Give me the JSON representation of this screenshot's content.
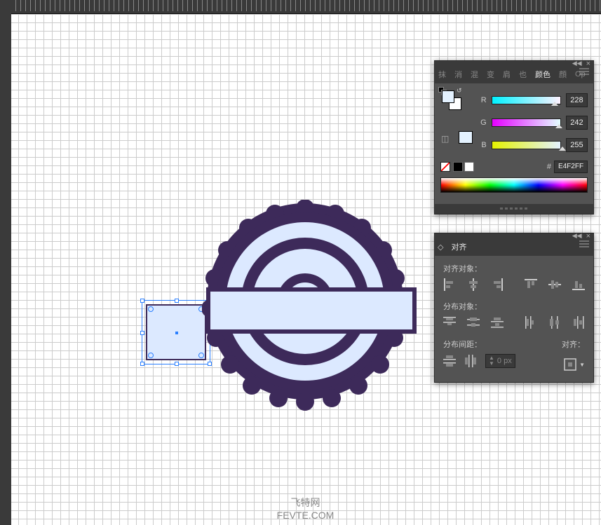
{
  "color_panel": {
    "tabs": [
      "抹",
      "消",
      "混",
      "变",
      "肩",
      "也"
    ],
    "active_tab": "颜色",
    "tabs_right": [
      "顔",
      "Op"
    ],
    "r_label": "R",
    "r_value": "228",
    "g_label": "G",
    "g_value": "242",
    "b_label": "B",
    "b_value": "255",
    "hex_label": "#",
    "hex_value": "E4F2FF",
    "fill_color": "#E4F2FF"
  },
  "align_panel": {
    "tab": "对齐",
    "section_align": "对齐对象：",
    "section_distribute": "分布对象：",
    "section_spacing": "分布间距：",
    "align_to_label": "对齐：",
    "spacing_value": "0 px",
    "buttons": {
      "align_left": "align-left",
      "align_hcenter": "align-hcenter",
      "align_right": "align-right",
      "align_top": "align-top",
      "align_vcenter": "align-vcenter",
      "align_bottom": "align-bottom",
      "dist_top": "dist-top",
      "dist_vcenter": "dist-vcenter",
      "dist_bottom": "dist-bottom",
      "dist_left": "dist-left",
      "dist_hcenter": "dist-hcenter",
      "dist_right": "dist-right",
      "space_v": "space-v",
      "space_h": "space-h",
      "align_to_artboard": "align-to-artboard"
    }
  },
  "watermark": {
    "line1": "飞特网",
    "line2": "FEVTE.COM"
  },
  "colors": {
    "badge_dark": "#3d2a5a",
    "badge_light": "#dce9ff",
    "selection": "#2a7fff"
  }
}
